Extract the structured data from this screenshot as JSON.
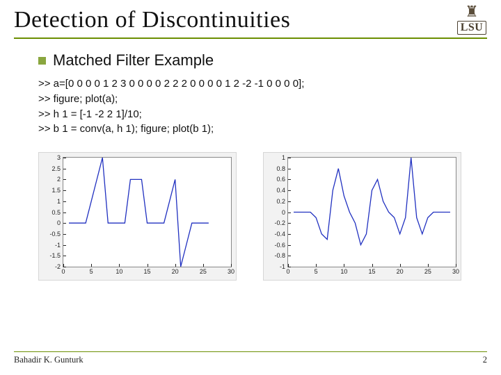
{
  "title": "Detection of Discontinuities",
  "logo": {
    "text": "LSU",
    "icon": "tower-icon"
  },
  "bullet": {
    "label": "Matched Filter Example"
  },
  "code_lines": [
    ">> a=[0 0 0 0 1 2 3 0 0 0 0 2 2 2 0 0 0 0 1 2 -2 -1 0 0 0 0];",
    ">> figure; plot(a);",
    ">> h 1 = [-1 -2 2 1]/10;",
    ">> b 1 = conv(a, h 1); figure; plot(b 1);"
  ],
  "footer": {
    "author": "Bahadir K. Gunturk",
    "page": "2"
  },
  "chart_data": [
    {
      "type": "line",
      "title": "",
      "xlabel": "",
      "ylabel": "",
      "xlim": [
        0,
        30
      ],
      "ylim": [
        -2,
        3
      ],
      "xticks": [
        0,
        5,
        10,
        15,
        20,
        25,
        30
      ],
      "yticks": [
        -2,
        -1.5,
        -1,
        -0.5,
        0,
        0.5,
        1,
        1.5,
        2,
        2.5,
        3
      ],
      "x": [
        1,
        2,
        3,
        4,
        5,
        6,
        7,
        8,
        9,
        10,
        11,
        12,
        13,
        14,
        15,
        16,
        17,
        18,
        19,
        20,
        21,
        22,
        23,
        24,
        25,
        26
      ],
      "values": [
        0,
        0,
        0,
        0,
        1,
        2,
        3,
        0,
        0,
        0,
        0,
        2,
        2,
        2,
        0,
        0,
        0,
        0,
        1,
        2,
        -2,
        -1,
        0,
        0,
        0,
        0
      ]
    },
    {
      "type": "line",
      "title": "",
      "xlabel": "",
      "ylabel": "",
      "xlim": [
        0,
        30
      ],
      "ylim": [
        -1,
        1
      ],
      "xticks": [
        0,
        5,
        10,
        15,
        20,
        25,
        30
      ],
      "yticks": [
        -1,
        -0.8,
        -0.6,
        -0.4,
        -0.2,
        0,
        0.2,
        0.4,
        0.6,
        0.8,
        1
      ],
      "x": [
        1,
        2,
        3,
        4,
        5,
        6,
        7,
        8,
        9,
        10,
        11,
        12,
        13,
        14,
        15,
        16,
        17,
        18,
        19,
        20,
        21,
        22,
        23,
        24,
        25,
        26,
        27,
        28,
        29
      ],
      "values": [
        0,
        0,
        0,
        0,
        -0.1,
        -0.4,
        -0.5,
        0.4,
        0.8,
        0.3,
        0,
        -0.2,
        -0.6,
        -0.4,
        0.4,
        0.6,
        0.2,
        0,
        -0.1,
        -0.4,
        -0.1,
        1.0,
        -0.1,
        -0.4,
        -0.1,
        0,
        0,
        0,
        0
      ]
    }
  ]
}
